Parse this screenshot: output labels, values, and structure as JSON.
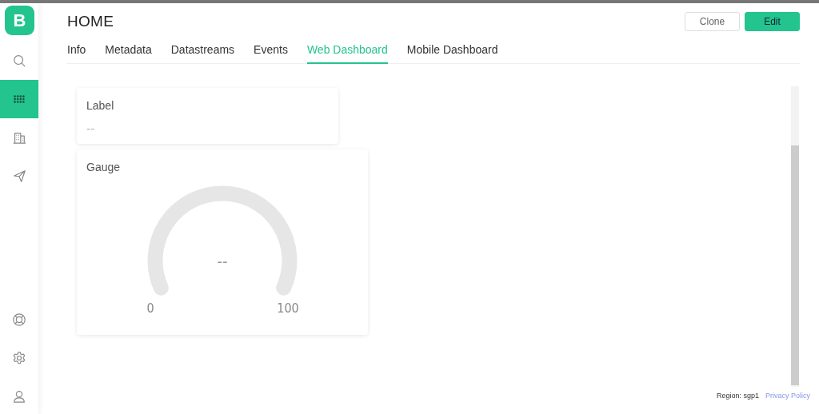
{
  "sidebar": {
    "logo": "B",
    "top_items": [
      {
        "kind": "search",
        "selected": false
      },
      {
        "kind": "grid",
        "selected": true
      },
      {
        "kind": "building",
        "selected": false
      },
      {
        "kind": "send",
        "selected": false
      }
    ],
    "bottom_items": [
      {
        "kind": "lifebuoy",
        "selected": false
      },
      {
        "kind": "settings",
        "selected": false
      },
      {
        "kind": "user",
        "selected": false
      }
    ]
  },
  "header": {
    "title": "HOME",
    "buttons": [
      {
        "label": "Clone",
        "kind": "secondary"
      },
      {
        "label": "Edit",
        "kind": "primary"
      }
    ]
  },
  "tabs": [
    {
      "label": "Info",
      "selected": false
    },
    {
      "label": "Metadata",
      "selected": false
    },
    {
      "label": "Datastreams",
      "selected": false
    },
    {
      "label": "Events",
      "selected": false
    },
    {
      "label": "Web Dashboard",
      "selected": true
    },
    {
      "label": "Mobile Dashboard",
      "selected": false
    }
  ],
  "widgets": [
    {
      "kind": "label",
      "title": "Label",
      "value": "--"
    },
    {
      "kind": "gauge",
      "title": "Gauge",
      "value": "--",
      "min": "0",
      "max": "100"
    }
  ],
  "footer": {
    "region": "Region: sgp1",
    "link": "Privacy Policy"
  }
}
